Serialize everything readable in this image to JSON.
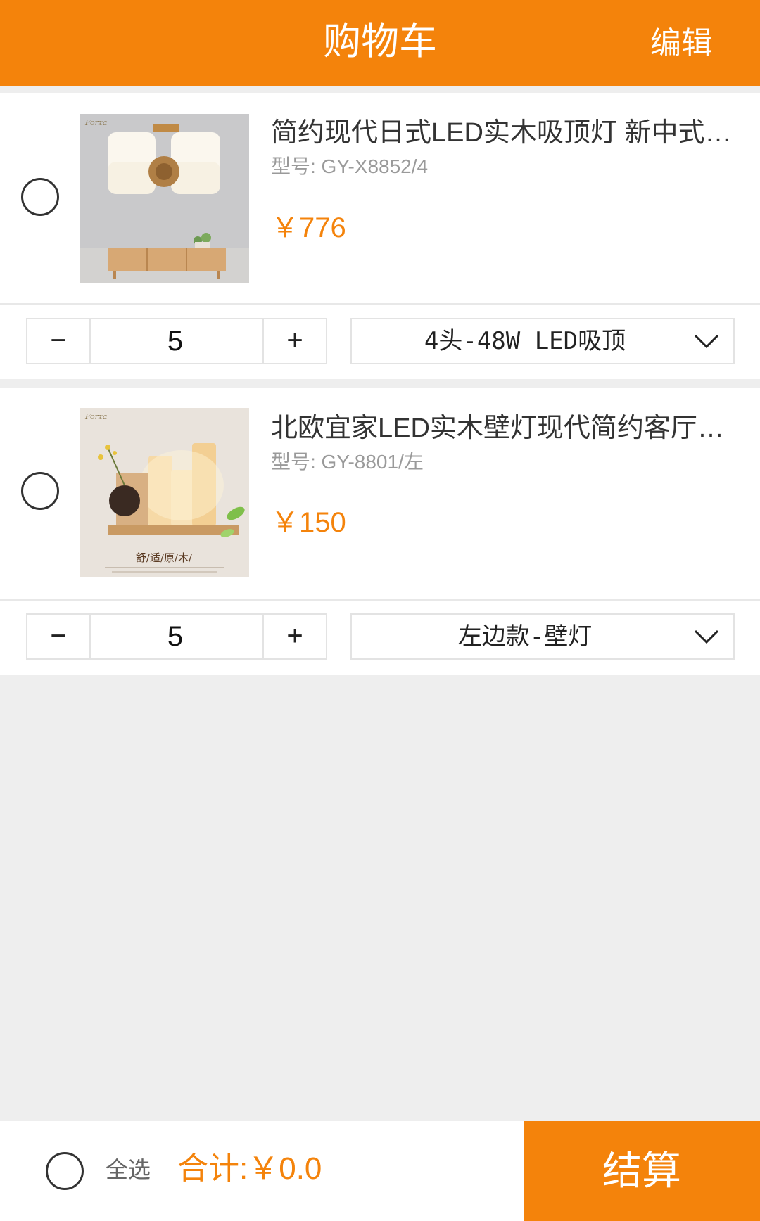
{
  "header": {
    "title": "购物车",
    "edit_label": "编辑"
  },
  "items": [
    {
      "title": "简约现代日式LED实木吸顶灯 新中式客厅灯",
      "model": "型号: GY-X8852/4",
      "price": "￥776",
      "quantity": "5",
      "minus_label": "−",
      "plus_label": "+",
      "variant": "4头-48W LED吸顶",
      "thumb_brand": "Forza"
    },
    {
      "title": "北欧宜家LED实木壁灯现代简约客厅卧室床头灯",
      "model": "型号: GY-8801/左",
      "price": "￥150",
      "quantity": "5",
      "minus_label": "−",
      "plus_label": "+",
      "variant": "左边款-壁灯",
      "thumb_brand": "Forza",
      "thumb_caption": "舒/适/原/木/"
    }
  ],
  "footer": {
    "select_all_label": "全选",
    "total_label": "合计:￥0.0",
    "checkout_label": "结算"
  },
  "colors": {
    "accent": "#f4830b",
    "background": "#eeeeee",
    "text_muted": "#9a9a9a"
  }
}
